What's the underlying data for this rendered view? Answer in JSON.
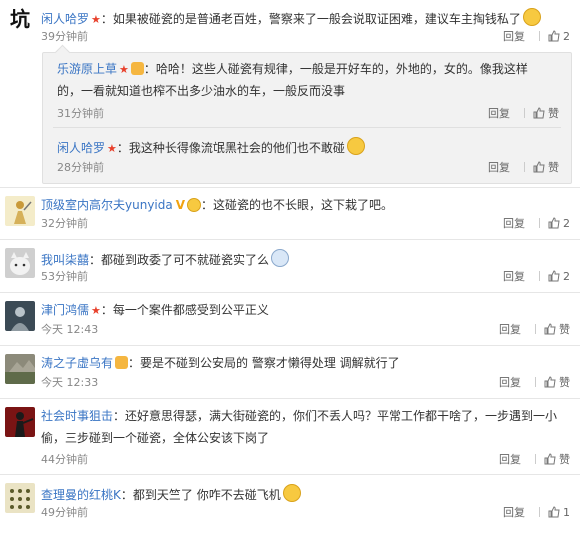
{
  "comments": [
    {
      "avatar_char": "坑",
      "user": "闲人哈罗",
      "text": "如果被碰瓷的是普通老百姓，警察来了一般会说取证困难，建议车主掏钱私了",
      "time": "39分钟前",
      "reply": "回复",
      "likes": "2"
    },
    {
      "user": "乐游原上草",
      "text": "哈哈！这些人碰瓷有规律，一般是开好车的，外地的，女的。像我这样",
      "text2": "的，一看就知道也榨不出多少油水的车，一般反而没事",
      "time": "31分钟前",
      "reply": "回复",
      "likes": "赞"
    },
    {
      "user": "闲人哈罗",
      "text": "我这种长得像流氓黑社会的他们也不敢碰",
      "time": "28分钟前",
      "reply": "回复",
      "likes": "赞"
    },
    {
      "user": "顶级室内高尔夫yunyida",
      "text": "这碰瓷的也不长眼，这下栽了吧。",
      "time": "32分钟前",
      "reply": "回复",
      "likes": "2"
    },
    {
      "user": "我叫柒囍",
      "text": "都碰到政委了可不就碰瓷实了么",
      "time": "53分钟前",
      "reply": "回复",
      "likes": "2"
    },
    {
      "user": "津门鸿儒",
      "text": "每一个案件都感受到公平正义",
      "time": "今天 12:43",
      "reply": "回复",
      "likes": "赞"
    },
    {
      "user": "涛之子虚乌有",
      "text": "要是不碰到公安局的 警察才懒得处理 调解就行了",
      "time": "今天 12:33",
      "reply": "回复",
      "likes": "赞"
    },
    {
      "user": "社会时事狙击",
      "text": "还好意思得瑟，满大街碰瓷的，你们不丢人吗？平常工作都干啥了，一步遇到一小",
      "text2": "偷，三步碰到一个碰瓷，全体公安该下岗了",
      "time": "44分钟前",
      "reply": "回复",
      "likes": "赞"
    },
    {
      "user": "查理曼的红桃K",
      "text": "都到天竺了 你咋不去碰飞机",
      "time": "49分钟前",
      "reply": "回复",
      "likes": "1"
    }
  ],
  "colors": {
    "username": "#3a75c4",
    "star": "#e8402b",
    "vip": "#f1a20f"
  },
  "icons": [
    "thumbs-up-icon",
    "star-badge-icon",
    "vip-badge-icon",
    "emoji-icon"
  ]
}
